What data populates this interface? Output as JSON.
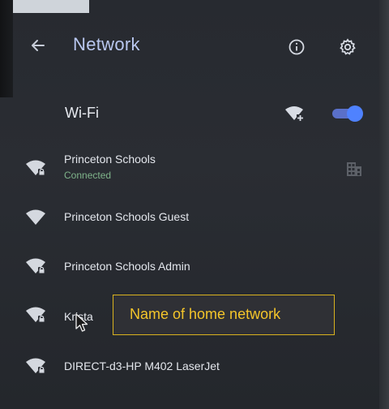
{
  "header": {
    "title": "Network",
    "back_icon": "arrow-left-icon",
    "info_icon": "info-circle-icon",
    "settings_icon": "gear-icon"
  },
  "wifi": {
    "label": "Wi-Fi",
    "enabled": true,
    "add_icon": "add-wifi-icon"
  },
  "networks": [
    {
      "name": "Princeton Schools",
      "status": "Connected",
      "icon": "wifi-locked-icon",
      "extra_icon": "building-icon"
    },
    {
      "name": "Princeton Schools Guest",
      "icon": "wifi-icon"
    },
    {
      "name": "Princeton Schools Admin",
      "icon": "wifi-locked-icon"
    },
    {
      "name": "Krista",
      "icon": "wifi-locked-icon"
    },
    {
      "name": "DIRECT-d3-HP M402 LaserJet",
      "icon": "wifi-locked-icon"
    }
  ],
  "annotation": {
    "text": "Name of home network"
  },
  "colors": {
    "title": "#b9c7f0",
    "toggle": "#4f82ff",
    "connected": "#7fb38a",
    "annotation": "#f4c52a"
  }
}
